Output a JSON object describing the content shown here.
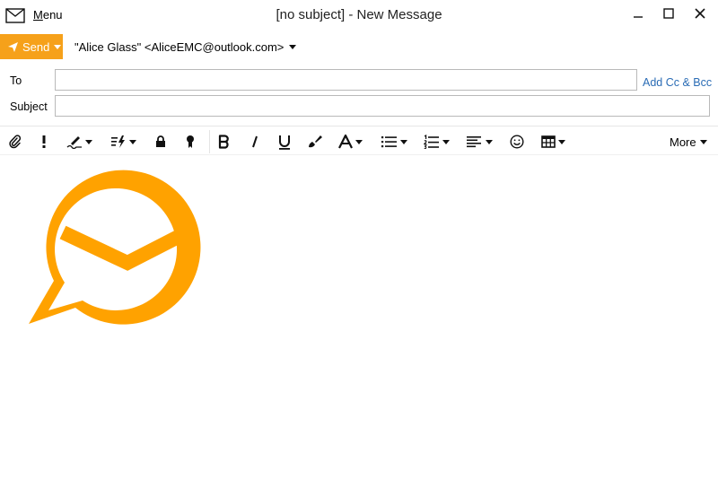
{
  "window": {
    "title": "[no subject] - New Message",
    "menu_label": "Menu"
  },
  "compose": {
    "send_label": "Send",
    "from": "\"Alice Glass\" <AliceEMC@outlook.com>",
    "to_label": "To",
    "to_value": "",
    "add_cc_bcc": "Add Cc & Bcc",
    "subject_label": "Subject",
    "subject_value": ""
  },
  "toolbar": {
    "more_label": "More",
    "icons": [
      "attach-icon",
      "priority-icon",
      "signature-icon",
      "quick-text-icon",
      "encrypt-icon",
      "sign-icon",
      "bold-icon",
      "italic-icon",
      "underline-icon",
      "format-painter-icon",
      "font-icon",
      "bullet-list-icon",
      "numbered-list-icon",
      "align-icon",
      "emoji-icon",
      "table-icon"
    ]
  },
  "colors": {
    "accent": "#f6a11a",
    "link": "#2a6cb5",
    "logo": "#ffa200"
  }
}
